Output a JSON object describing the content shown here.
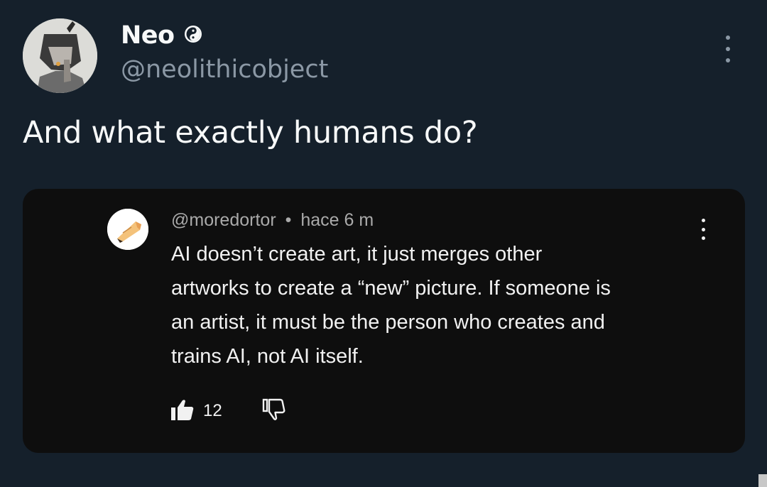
{
  "tweet": {
    "display_name": "Neo",
    "handle": "@neolithicobject",
    "text": "And what exactly humans do?",
    "badge_icon": "yin-yang-icon",
    "menu_icon": "more-vertical-icon"
  },
  "quoted_comment": {
    "username": "@moredortor",
    "separator": "•",
    "time": "hace 6 m",
    "lines": [
      "AI doesn’t create art, it just merges other",
      "artworks to create a “new” picture. If someone is",
      "an artist, it must be the person who creates and",
      "trains AI, not AI itself."
    ],
    "like_count": "12",
    "like_icon": "thumbs-up-icon",
    "dislike_icon": "thumbs-down-icon",
    "menu_icon": "more-vertical-icon"
  },
  "colors": {
    "background": "#15202b",
    "card_background": "#0e0e0e",
    "secondary_text": "#8b98a5",
    "primary_text": "#f7f9f9"
  }
}
